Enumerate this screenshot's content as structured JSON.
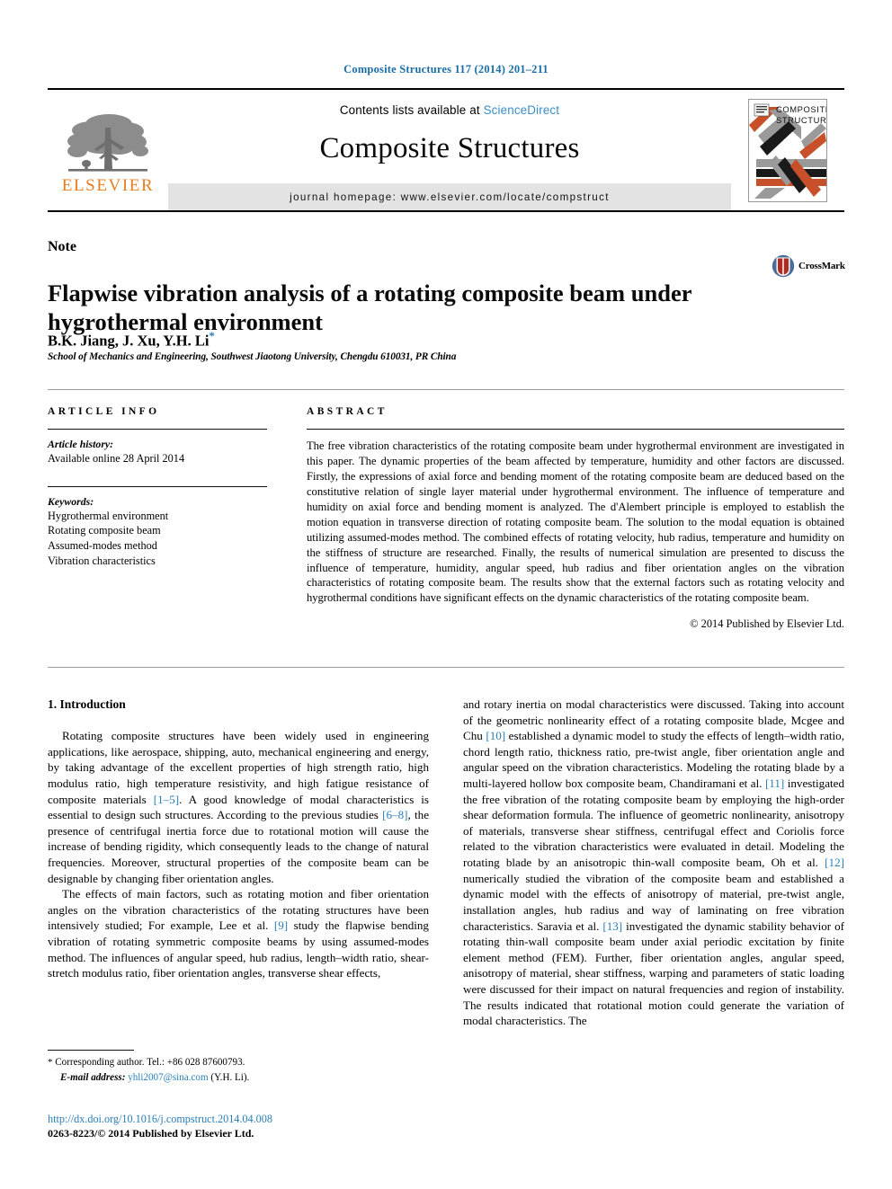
{
  "running_head": "Composite Structures 117 (2014) 201–211",
  "masthead": {
    "publisher_logo_text": "ELSEVIER",
    "contents_prefix": "Contents lists available at ",
    "contents_link": "ScienceDirect",
    "journal_title": "Composite Structures",
    "homepage": "journal homepage: www.elsevier.com/locate/compstruct",
    "cover_title_line1": "COMPOSITE",
    "cover_title_line2": "STRUCTURES"
  },
  "article": {
    "type_label": "Note",
    "title": "Flapwise vibration analysis of a rotating composite beam under hygrothermal environment",
    "authors": "B.K. Jiang, J. Xu, Y.H. Li",
    "corresponding_marker": "*",
    "affiliation": "School of Mechanics and Engineering, Southwest Jiaotong University, Chengdu 610031, PR China",
    "crossmark_label": "CrossMark"
  },
  "article_info": {
    "heading": "ARTICLE INFO",
    "history_label": "Article history:",
    "history_value": "Available online 28 April 2014",
    "keywords_label": "Keywords:",
    "keywords": [
      "Hygrothermal environment",
      "Rotating composite beam",
      "Assumed-modes method",
      "Vibration characteristics"
    ]
  },
  "abstract": {
    "heading": "ABSTRACT",
    "text": "The free vibration characteristics of the rotating composite beam under hygrothermal environment are investigated in this paper. The dynamic properties of the beam affected by temperature, humidity and other factors are discussed. Firstly, the expressions of axial force and bending moment of the rotating composite beam are deduced based on the constitutive relation of single layer material under hygrothermal environment. The influence of temperature and humidity on axial force and bending moment is analyzed. The d'Alembert principle is employed to establish the motion equation in transverse direction of rotating composite beam. The solution to the modal equation is obtained utilizing assumed-modes method. The combined effects of rotating velocity, hub radius, temperature and humidity on the stiffness of structure are researched. Finally, the results of numerical simulation are presented to discuss the influence of temperature, humidity, angular speed, hub radius and fiber orientation angles on the vibration characteristics of rotating composite beam. The results show that the external factors such as rotating velocity and hygrothermal conditions have significant effects on the dynamic characteristics of the rotating composite beam.",
    "copyright": "© 2014 Published by Elsevier Ltd."
  },
  "body": {
    "section_heading": "1. Introduction",
    "left_paragraphs": [
      {
        "segments": [
          {
            "t": "Rotating composite structures have been widely used in engineering applications, like aerospace, shipping, auto, mechanical engineering and energy, by taking advantage of the excellent properties of high strength ratio, high modulus ratio, high temperature resistivity, and high fatigue resistance of composite materials "
          },
          {
            "t": "[1–5]",
            "ref": true
          },
          {
            "t": ". A good knowledge of modal characteristics is essential to design such structures. According to the previous studies "
          },
          {
            "t": "[6–8]",
            "ref": true
          },
          {
            "t": ", the presence of centrifugal inertia force due to rotational motion will cause the increase of bending rigidity, which consequently leads to the change of natural frequencies. Moreover, structural properties of the composite beam can be designable by changing fiber orientation angles."
          }
        ]
      },
      {
        "segments": [
          {
            "t": "The effects of main factors, such as rotating motion and fiber orientation angles on the vibration characteristics of the rotating structures have been intensively studied; For example, Lee et al. "
          },
          {
            "t": "[9]",
            "ref": true
          },
          {
            "t": " study the flapwise bending vibration of rotating symmetric composite beams by using assumed-modes method. The influences of angular speed, hub radius, length–width ratio, shear-stretch modulus ratio, fiber orientation angles, transverse shear effects,"
          }
        ]
      }
    ],
    "right_paragraphs": [
      {
        "continuation": true,
        "segments": [
          {
            "t": "and rotary inertia on modal characteristics were discussed. Taking into account of the geometric nonlinearity effect of a rotating composite blade, Mcgee and Chu "
          },
          {
            "t": "[10]",
            "ref": true
          },
          {
            "t": " established a dynamic model to study the effects of length–width ratio, chord length ratio, thickness ratio, pre-twist angle, fiber orientation angle and angular speed on the vibration characteristics. Modeling the rotating blade by a multi-layered hollow box composite beam, Chandiramani et al. "
          },
          {
            "t": "[11]",
            "ref": true
          },
          {
            "t": " investigated the free vibration of the rotating composite beam by employing the high-order shear deformation formula. The influence of geometric nonlinearity, anisotropy of materials, transverse shear stiffness, centrifugal effect and Coriolis force related to the vibration characteristics were evaluated in detail. Modeling the rotating blade by an anisotropic thin-wall composite beam, Oh et al. "
          },
          {
            "t": "[12]",
            "ref": true
          },
          {
            "t": " numerically studied the vibration of the composite beam and established a dynamic model with the effects of anisotropy of material, pre-twist angle, installation angles, hub radius and way of laminating on free vibration characteristics. Saravia et al. "
          },
          {
            "t": "[13]",
            "ref": true
          },
          {
            "t": " investigated the dynamic stability behavior of rotating thin-wall composite beam under axial periodic excitation by finite element method (FEM). Further, fiber orientation angles, angular speed, anisotropy of material, shear stiffness, warping and parameters of static loading were discussed for their impact on natural frequencies and region of instability. The results indicated that rotational motion could generate the variation of modal characteristics. The"
          }
        ]
      }
    ]
  },
  "footnote": {
    "star": "*",
    "corresponding": "Corresponding author. Tel.: +86 028 87600793.",
    "email_label": "E-mail address:",
    "email": "yhli2007@sina.com",
    "email_owner": "(Y.H. Li)."
  },
  "footer": {
    "doi": "http://dx.doi.org/10.1016/j.compstruct.2014.04.008",
    "issn_line": "0263-8223/© 2014 Published by Elsevier Ltd."
  },
  "colors": {
    "link": "#2a7fb8",
    "running_head": "#1a6ea8",
    "elsevier_orange": "#E87D1E",
    "sciencedirect": "#3A8DC4",
    "cover_orange": "#C7502A",
    "cover_grey": "#9a9a9a"
  }
}
